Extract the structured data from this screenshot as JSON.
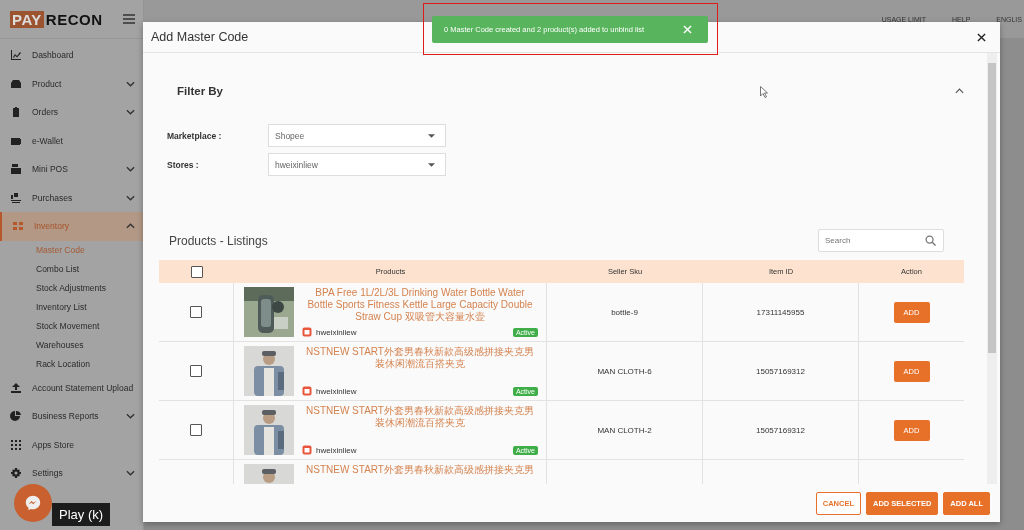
{
  "app": {
    "logo_left": "PAY",
    "logo_right": "RECON"
  },
  "header": {
    "items": [
      "USAGE LIMIT",
      "HELP",
      "ENGLIS"
    ]
  },
  "sidebar": {
    "items": [
      {
        "label": "Dashboard",
        "kind": "link",
        "selected": false
      },
      {
        "label": "Product",
        "kind": "group",
        "expanded": false,
        "selected": false
      },
      {
        "label": "Orders",
        "kind": "group",
        "expanded": false,
        "selected": false
      },
      {
        "label": "e-Wallet",
        "kind": "link",
        "selected": false
      },
      {
        "label": "Mini POS",
        "kind": "group",
        "expanded": false,
        "selected": false
      },
      {
        "label": "Purchases",
        "kind": "group",
        "expanded": false,
        "selected": false
      },
      {
        "label": "Inventory",
        "kind": "group",
        "expanded": true,
        "selected": true,
        "children": [
          {
            "label": "Master Code",
            "selected": true
          },
          {
            "label": "Combo List",
            "selected": false
          },
          {
            "label": "Stock Adjustments",
            "selected": false
          },
          {
            "label": "Inventory List",
            "selected": false
          },
          {
            "label": "Stock Movement",
            "selected": false
          },
          {
            "label": "Warehouses",
            "selected": false
          },
          {
            "label": "Rack Location",
            "selected": false
          }
        ]
      },
      {
        "label": "Account Statement Upload",
        "kind": "link",
        "selected": false
      },
      {
        "label": "Business Reports",
        "kind": "group",
        "expanded": false,
        "selected": false
      },
      {
        "label": "Apps Store",
        "kind": "link",
        "selected": false
      },
      {
        "label": "Settings",
        "kind": "group",
        "expanded": false,
        "selected": false
      }
    ]
  },
  "toast": {
    "message": "0 Master Code created and 2 product(s) added to unbind list",
    "highlighted": true
  },
  "modal": {
    "title": "Add Master Code",
    "filter": {
      "title": "Filter By",
      "expanded": true,
      "fields": [
        {
          "label": "Marketplace :",
          "value": "Shopee"
        },
        {
          "label": "Stores :",
          "value": "hweixinliew"
        }
      ]
    },
    "listings": {
      "title": "Products - Listings",
      "search_placeholder": "Search",
      "select_all_checked": false,
      "columns": [
        "Products",
        "Seller Sku",
        "Item ID",
        "Action"
      ],
      "rows": [
        {
          "checked": false,
          "title": "BPA Free 1L/2L/3L Drinking Water Bottle Water Bottle Sports Fitness Kettle Large Capacity Double Straw Cup 双吸管大容量水壶",
          "store": "hweixinliew",
          "status": "Active",
          "seller_sku": "bottle-9",
          "item_id": "17311145955",
          "action": "ADD"
        },
        {
          "checked": false,
          "title": "NSTNEW START外套男春秋新款高级感拼接夹克男装休闲潮流百搭夹克",
          "store": "hweixinliew",
          "status": "Active",
          "seller_sku": "MAN CLOTH-6",
          "item_id": "15057169312",
          "action": "ADD"
        },
        {
          "checked": false,
          "title": "NSTNEW START外套男春秋新款高级感拼接夹克男装休闲潮流百搭夹克",
          "store": "hweixinliew",
          "status": "Active",
          "seller_sku": "MAN CLOTH-2",
          "item_id": "15057169312",
          "action": "ADD"
        },
        {
          "title": "NSTNEW START外套男春秋新款高级感拼接夹克男"
        }
      ]
    },
    "buttons": [
      {
        "label": "CANCEL",
        "kind": "outline"
      },
      {
        "label": "ADD SELECTED",
        "kind": "filled"
      },
      {
        "label": "ADD ALL",
        "kind": "filled"
      }
    ]
  },
  "player": {
    "tooltip": "Play (k)"
  }
}
